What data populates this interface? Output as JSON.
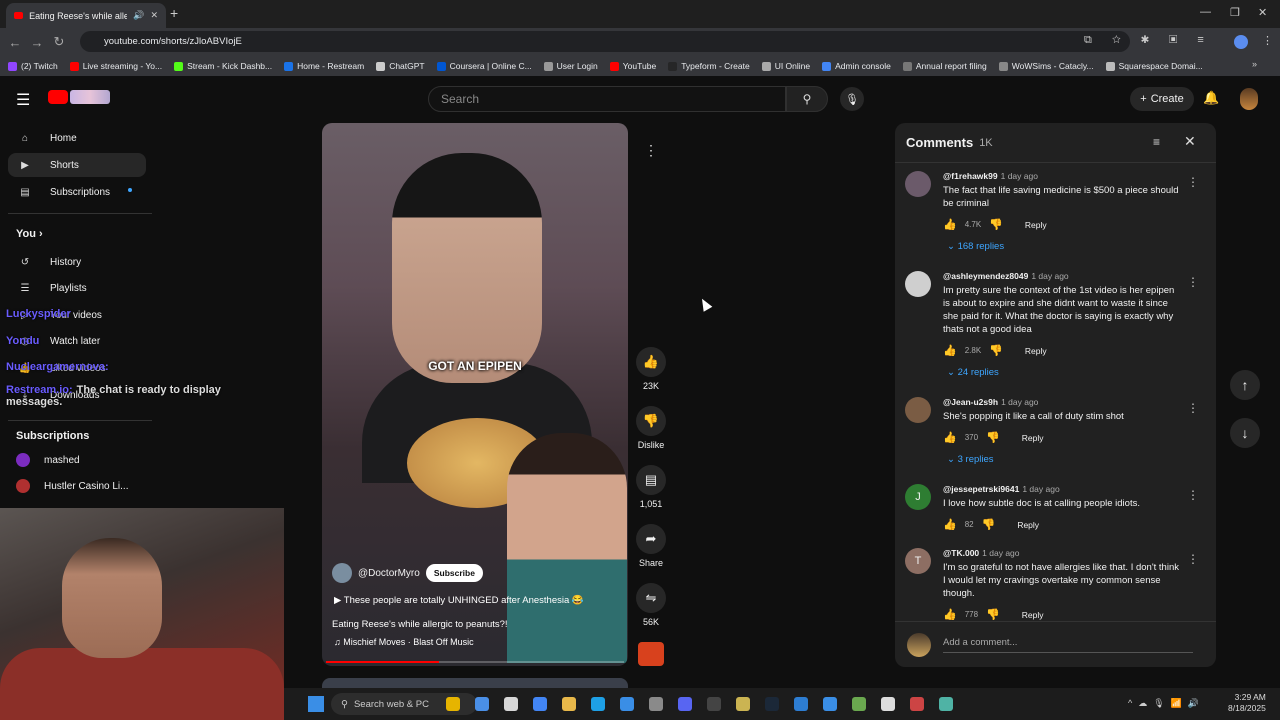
{
  "browser": {
    "tab_title": "Eating Reese's while allergi...",
    "url": "youtube.com/shorts/zJloABVIojE",
    "bookmarks": [
      {
        "label": "(2) Twitch",
        "color": "#9146ff"
      },
      {
        "label": "Live streaming - Yo...",
        "color": "#ff0000"
      },
      {
        "label": "Stream - Kick Dashb...",
        "color": "#53fc18"
      },
      {
        "label": "Home - Restream",
        "color": "#1a73e8"
      },
      {
        "label": "ChatGPT",
        "color": "#cccccc"
      },
      {
        "label": "Coursera | Online C...",
        "color": "#0056d2"
      },
      {
        "label": "User Login",
        "color": "#999999"
      },
      {
        "label": "YouTube",
        "color": "#ff0000"
      },
      {
        "label": "Typeform - Create",
        "color": "#262627"
      },
      {
        "label": "UI Online",
        "color": "#aaaaaa"
      },
      {
        "label": "Admin console",
        "color": "#4285f4"
      },
      {
        "label": "Annual report filing",
        "color": "#777777"
      },
      {
        "label": "WoWSims - Catacly...",
        "color": "#888888"
      },
      {
        "label": "Squarespace Domai...",
        "color": "#bbbbbb"
      }
    ]
  },
  "header": {
    "search_placeholder": "Search",
    "create_label": "Create"
  },
  "sidebar": {
    "items": [
      {
        "label": "Home",
        "icon": "home-icon",
        "glyph": "⌂"
      },
      {
        "label": "Shorts",
        "icon": "shorts-icon",
        "glyph": "▶"
      },
      {
        "label": "Subscriptions",
        "icon": "subscriptions-icon",
        "glyph": "▤"
      }
    ],
    "you_label": "You",
    "you_items": [
      {
        "label": "History",
        "icon": "history-icon",
        "glyph": "↺"
      },
      {
        "label": "Playlists",
        "icon": "playlists-icon",
        "glyph": "☰"
      },
      {
        "label": "Your videos",
        "icon": "your-videos-icon",
        "glyph": "▷"
      },
      {
        "label": "Watch later",
        "icon": "watch-later-icon",
        "glyph": "◷"
      },
      {
        "label": "Liked videos",
        "icon": "liked-videos-icon",
        "glyph": "👍"
      },
      {
        "label": "Downloads",
        "icon": "downloads-icon",
        "glyph": "⤓"
      }
    ],
    "subscriptions_label": "Subscriptions",
    "subscriptions": [
      {
        "label": "mashed",
        "color": "#7b2cbf"
      },
      {
        "label": "Hustler Casino Li...",
        "color": "#b03030"
      }
    ]
  },
  "overlay_chat": {
    "lines": [
      {
        "user": "Luckyspider",
        "text": ""
      },
      {
        "user": "Yondu",
        "text": ""
      },
      {
        "user": "Nucleargamernova:",
        "text": ""
      },
      {
        "user": "Restream.io:",
        "text": "The chat is ready to display messages."
      }
    ]
  },
  "video": {
    "caption": "GOT AN EPIPEN",
    "channel": "@DoctorMyro",
    "subscribe": "Subscribe",
    "title_line": "These people are totally UNHINGED after Anesthesia 😂",
    "description": "Eating Reese's while allergic to peanuts?!",
    "music": "Mischief Moves · Blast Off Music",
    "progress": 0.38
  },
  "actions": {
    "likes": "23K",
    "dislike": "Dislike",
    "comments": "1,051",
    "share": "Share",
    "remix": "56K"
  },
  "comments": {
    "title": "Comments",
    "count": "1K",
    "items": [
      {
        "user": "@f1rehawk99",
        "time": "1 day ago",
        "text": "The fact that life saving medicine is $500 a piece should be criminal",
        "likes": "4.7K",
        "replies": "168 replies",
        "avatar_letter": "",
        "avatar_color": "#6b5a6a"
      },
      {
        "user": "@ashleymendez8049",
        "time": "1 day ago",
        "text": "Im pretty sure the context of the 1st video is her epipen is about to expire and she didnt want to waste it since she paid for it. What the doctor is saying is exactly why thats not a good idea",
        "likes": "2.8K",
        "replies": "24 replies",
        "avatar_letter": "",
        "avatar_color": "#cfcfcf"
      },
      {
        "user": "@Jean-u2s9h",
        "time": "1 day ago",
        "text": "She's popping it like a call of duty stim shot",
        "likes": "370",
        "replies": "3 replies",
        "avatar_letter": "",
        "avatar_color": "#7a5c44"
      },
      {
        "user": "@jessepetrski9641",
        "time": "1 day ago",
        "text": "I love how subtle doc is at calling people idiots.",
        "likes": "82",
        "replies": "",
        "avatar_letter": "J",
        "avatar_color": "#2e7d32"
      },
      {
        "user": "@TK.000",
        "time": "1 day ago",
        "text": "I'm so grateful to not have allergies like that. I don't think I would let my cravings overtake my common sense though.",
        "likes": "778",
        "replies": "",
        "avatar_letter": "T",
        "avatar_color": "#8d6e63"
      }
    ],
    "reply_label": "Reply",
    "add_placeholder": "Add a comment..."
  },
  "taskbar": {
    "search": "Search web & PC",
    "time": "3:29 AM",
    "date": "8/18/2025"
  }
}
